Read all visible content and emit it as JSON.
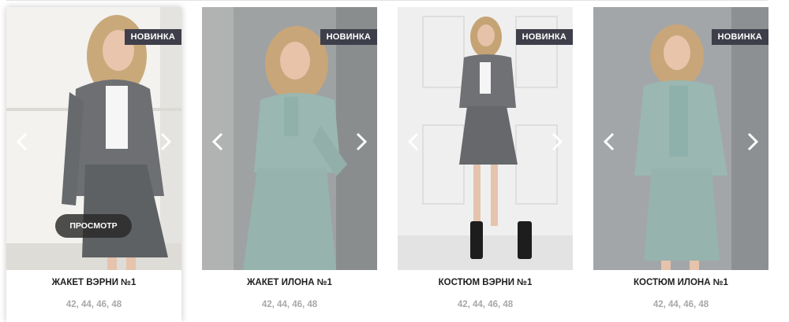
{
  "products": [
    {
      "title": "ЖАКЕТ ВЭРНИ №1",
      "badge": "НОВИНКА",
      "sizes": "42, 44, 46, 48",
      "view_label": "ПРОСМОТР"
    },
    {
      "title": "ЖАКЕТ ИЛОНА №1",
      "badge": "НОВИНКА",
      "sizes": "42, 44, 46, 48"
    },
    {
      "title": "КОСТЮМ ВЭРНИ №1",
      "badge": "НОВИНКА",
      "sizes": "42, 44, 46, 48"
    },
    {
      "title": "КОСТЮМ ИЛОНА №1",
      "badge": "НОВИНКА",
      "sizes": "42, 44, 46, 48"
    }
  ],
  "icons": {
    "prev": "chevron-left-icon",
    "next": "chevron-right-icon"
  },
  "colors": {
    "badge_bg": "#3f3f4b",
    "title_text": "#1e1e1e",
    "sizes_text": "#a8a8a8",
    "grey_suit": "#6d6f72",
    "mint_suit": "#9ab7b1"
  }
}
